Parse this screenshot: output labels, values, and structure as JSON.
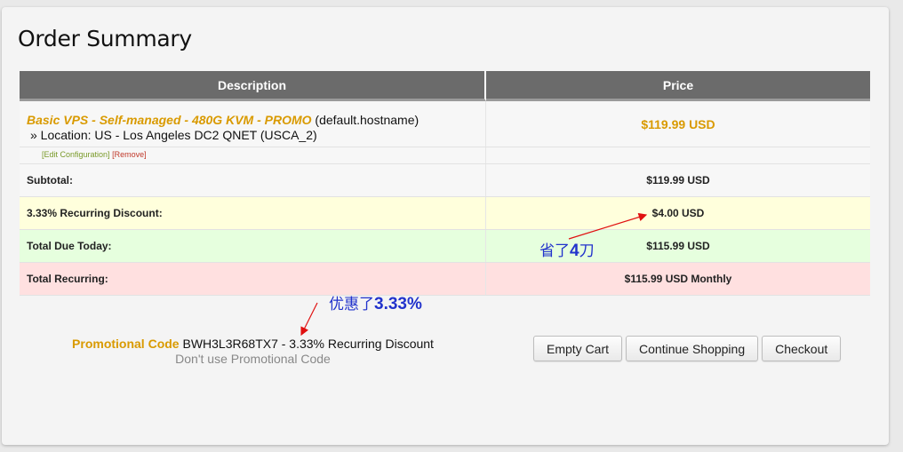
{
  "title": "Order Summary",
  "table": {
    "headers": {
      "description": "Description",
      "price": "Price"
    },
    "item": {
      "product": "Basic VPS - Self-managed - 480G KVM - PROMO",
      "hostname": "(default.hostname)",
      "location": "» Location: US - Los Angeles DC2 QNET (USCA_2)",
      "price": "$119.99 USD",
      "edit_link": "[Edit Configuration]",
      "remove_link": "[Remove]"
    },
    "subtotal": {
      "label": "Subtotal:",
      "value": "$119.99 USD"
    },
    "discount": {
      "label": "3.33% Recurring Discount:",
      "value": "$4.00 USD"
    },
    "due_today": {
      "label": "Total Due Today:",
      "value": "$115.99 USD"
    },
    "recurring": {
      "label": "Total Recurring:",
      "value": "$115.99 USD Monthly"
    }
  },
  "promo": {
    "label": "Promotional Code",
    "code_text": "BWH3L3R68TX7 - 3.33% Recurring Discount",
    "remove_text": "Don't use Promotional Code"
  },
  "buttons": {
    "empty_cart": "Empty Cart",
    "continue_shopping": "Continue Shopping",
    "checkout": "Checkout"
  },
  "annotations": {
    "saved_prefix": "省了",
    "saved_amount": "4",
    "saved_suffix": "刀",
    "discount_prefix": "优惠了",
    "discount_amount": "3.33%"
  },
  "colors": {
    "accent": "#d99a00",
    "header_bg": "#6b6b6b",
    "annotation": "#2233cc",
    "arrow": "#e01010"
  }
}
